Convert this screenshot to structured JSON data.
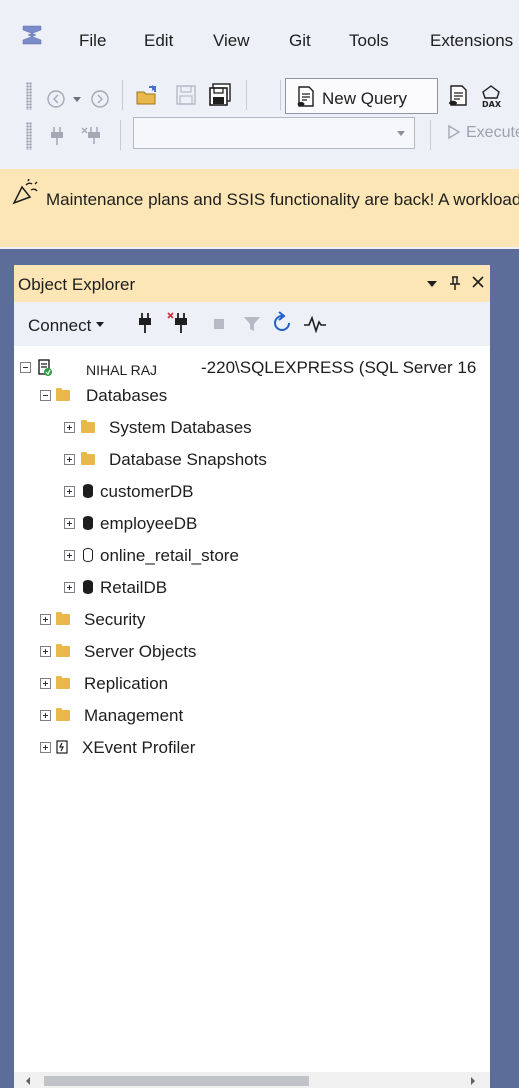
{
  "menu": {
    "items": [
      "File",
      "Edit",
      "View",
      "Git",
      "Tools",
      "Extensions"
    ]
  },
  "toolbar": {
    "new_query_label": "New Query",
    "execute_label": "Execute",
    "database_combo_value": ""
  },
  "banner": {
    "text": "Maintenance plans and SSIS functionality are back! A workload."
  },
  "object_explorer": {
    "title": "Object Explorer",
    "connect_label": "Connect",
    "pin_glyph": "I",
    "close_glyph": "✕",
    "server_label": "-220\\SQLEXPRESS (SQL Server 16",
    "overlay_label": "NIHAL RAJ",
    "nodes": [
      {
        "label": "Databases",
        "icon": "folder-icon",
        "expanded": true
      },
      {
        "label": "System Databases",
        "icon": "folder-icon",
        "expanded": false
      },
      {
        "label": "Database Snapshots",
        "icon": "folder-icon",
        "expanded": false
      },
      {
        "label": "customerDB",
        "icon": "database-icon",
        "expanded": false
      },
      {
        "label": "employeeDB",
        "icon": "database-icon",
        "expanded": false
      },
      {
        "label": "online_retail_store",
        "icon": "database-icon",
        "expanded": false
      },
      {
        "label": "RetailDB",
        "icon": "database-icon",
        "expanded": false
      },
      {
        "label": "Security",
        "icon": "folder-icon",
        "expanded": false
      },
      {
        "label": "Server Objects",
        "icon": "folder-icon",
        "expanded": false
      },
      {
        "label": "Replication",
        "icon": "folder-icon",
        "expanded": false
      },
      {
        "label": "Management",
        "icon": "folder-icon",
        "expanded": false
      },
      {
        "label": "XEvent Profiler",
        "icon": "xevent-icon",
        "expanded": false
      }
    ]
  },
  "colors": {
    "banner": "#fce6b6",
    "panel_frame": "#5d6d99",
    "folder": "#e8b84a"
  }
}
